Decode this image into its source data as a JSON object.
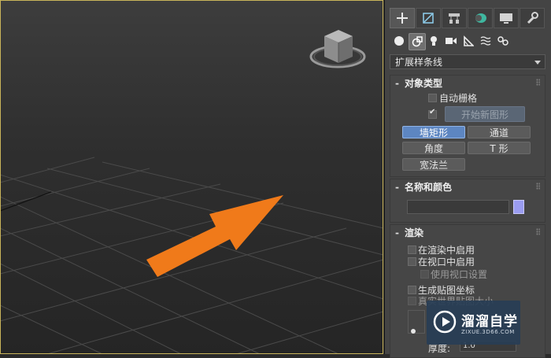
{
  "panel": {
    "tabs": [
      {
        "icon": "plus-icon",
        "active": true
      },
      {
        "icon": "modify-icon",
        "active": false
      },
      {
        "icon": "hierarchy-icon",
        "active": false
      },
      {
        "icon": "motion-icon",
        "active": false
      },
      {
        "icon": "display-icon",
        "active": false
      },
      {
        "icon": "utilities-wrench-icon",
        "active": false
      }
    ],
    "subtabs": [
      {
        "icon": "geometry-sphere-icon",
        "active": false
      },
      {
        "icon": "shapes-icon",
        "active": true
      },
      {
        "icon": "lights-icon",
        "active": false
      },
      {
        "icon": "cameras-icon",
        "active": false
      },
      {
        "icon": "helpers-icon",
        "active": false
      },
      {
        "icon": "space-warps-icon",
        "active": false
      },
      {
        "icon": "systems-icon",
        "active": false
      }
    ],
    "category_dropdown": "扩展样条线",
    "object_type": {
      "title": "对象类型",
      "auto_grid": "自动栅格",
      "auto_grid_checked": false,
      "start_new_shape_checked": true,
      "start_new_shape": "开始新图形",
      "buttons": [
        "墙矩形",
        "通道",
        "角度",
        "T 形",
        "宽法兰"
      ],
      "active_button": "墙矩形"
    },
    "name_color": {
      "title": "名称和颜色",
      "name_value": "",
      "swatch_color": "#9a9cf0"
    },
    "rendering": {
      "title": "渲染",
      "enable_in_renderer": "在渲染中启用",
      "enable_in_viewport": "在视口中启用",
      "use_viewport_settings": "使用视口设置",
      "generate_mapping_coords": "生成贴图坐标",
      "real_world_map_size": "真实世界贴图大小",
      "thickness_label": "厚度:",
      "thickness_value": "1.0"
    }
  },
  "watermark": {
    "title": "溜溜自学",
    "url": "ZIXUE.3D66.COM"
  },
  "accent": {
    "arrow_color": "#f07a1a",
    "viewport_border": "#c9b45a"
  }
}
